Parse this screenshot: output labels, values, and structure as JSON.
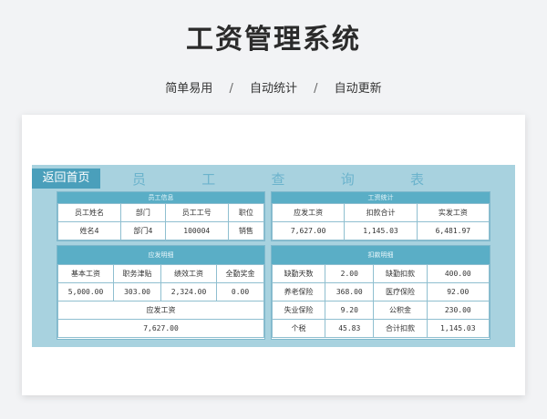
{
  "hero": {
    "title": "工资管理系统"
  },
  "taglines": [
    "简单易用",
    "自动统计",
    "自动更新"
  ],
  "tagline_sep": "/",
  "sheet": {
    "back_label": "返回首页",
    "title_chars": [
      "员",
      "工",
      "查",
      "询",
      "表"
    ],
    "info": {
      "head": "员工信息",
      "headers": [
        "员工姓名",
        "部门",
        "员工工号",
        "职位"
      ],
      "values": [
        "姓名4",
        "部门4",
        "100004",
        "销售"
      ]
    },
    "stats": {
      "head": "工资统计",
      "headers": [
        "应发工资",
        "扣款合计",
        "实发工资"
      ],
      "values": [
        "7,627.00",
        "1,145.03",
        "6,481.97"
      ]
    },
    "payable": {
      "head": "应发明细",
      "headers": [
        "基本工资",
        "职务津贴",
        "绩效工资",
        "全勤奖金"
      ],
      "values": [
        "5,000.00",
        "303.00",
        "2,324.00",
        "0.00"
      ],
      "total_label": "应发工资",
      "total_value": "7,627.00"
    },
    "deduct": {
      "head": "扣款明细",
      "rows": [
        [
          "缺勤天数",
          "2.00",
          "缺勤扣款",
          "400.00"
        ],
        [
          "养老保险",
          "368.00",
          "医疗保险",
          "92.00"
        ],
        [
          "失业保险",
          "9.20",
          "公积金",
          "230.00"
        ],
        [
          "个税",
          "45.83",
          "合计扣款",
          "1,145.03"
        ]
      ]
    }
  }
}
